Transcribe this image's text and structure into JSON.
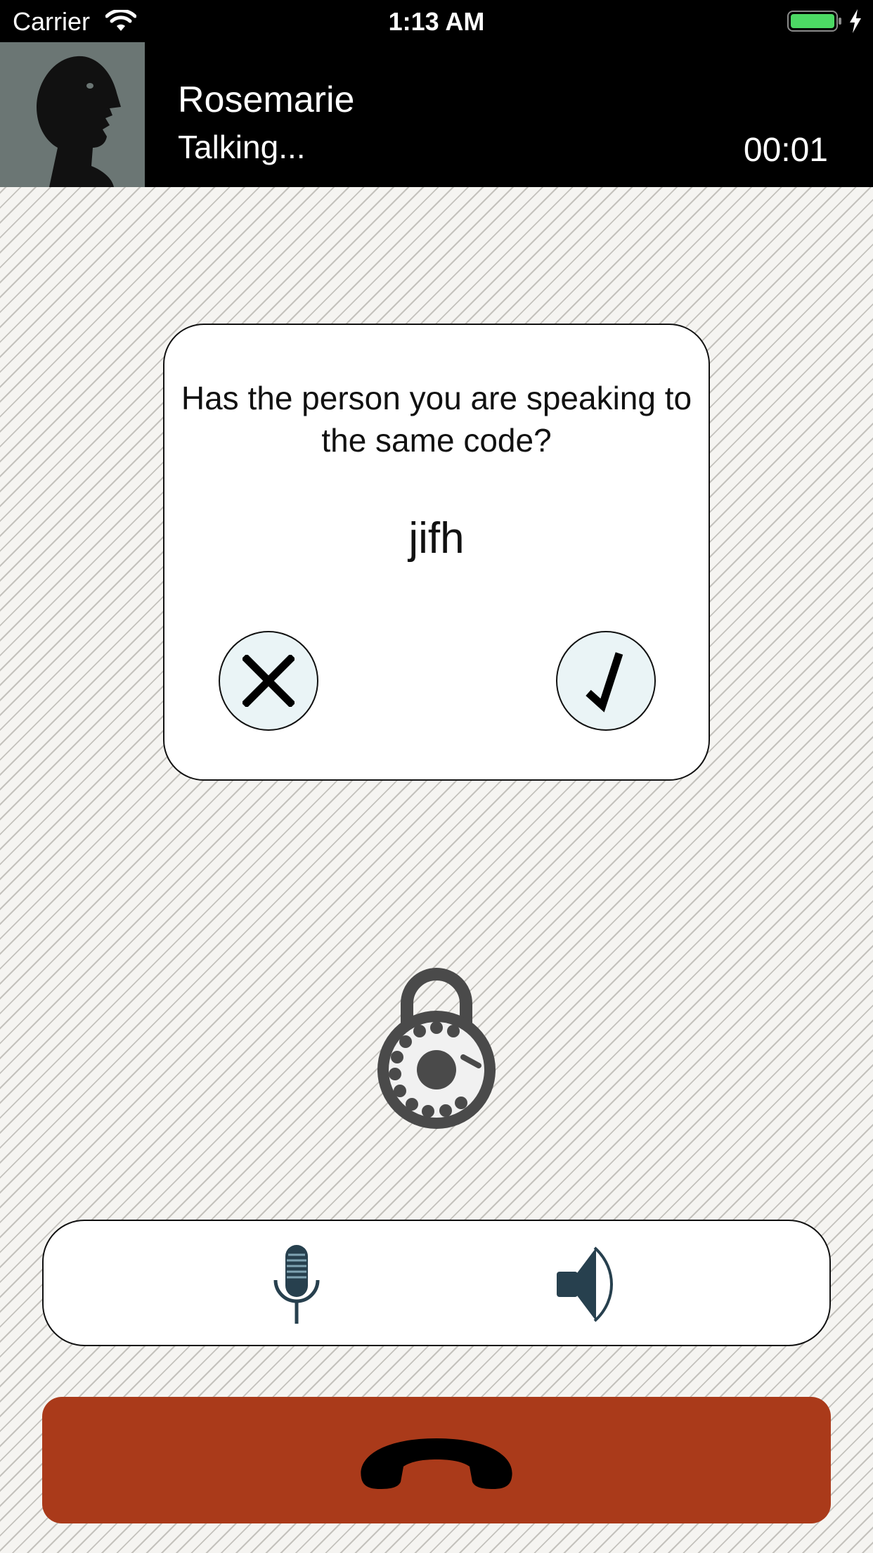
{
  "status_bar": {
    "carrier": "Carrier",
    "time": "1:13 AM",
    "battery_color": "#4cd964"
  },
  "call": {
    "contact_name": "Rosemarie",
    "status": "Talking...",
    "timer": "00:01"
  },
  "verify_dialog": {
    "question": "Has the person you are speaking to the same code?",
    "code": "jifh",
    "reject_icon": "x-icon",
    "confirm_icon": "checkmark-icon",
    "button_bg": "#eaf4f6"
  },
  "center_icon": "rotary-lock-icon",
  "controls": {
    "mic_icon": "microphone-icon",
    "speaker_icon": "speaker-icon",
    "icon_color": "#27404e"
  },
  "end_call": {
    "icon": "hang-up-phone-icon",
    "color": "#aa3a1a"
  }
}
